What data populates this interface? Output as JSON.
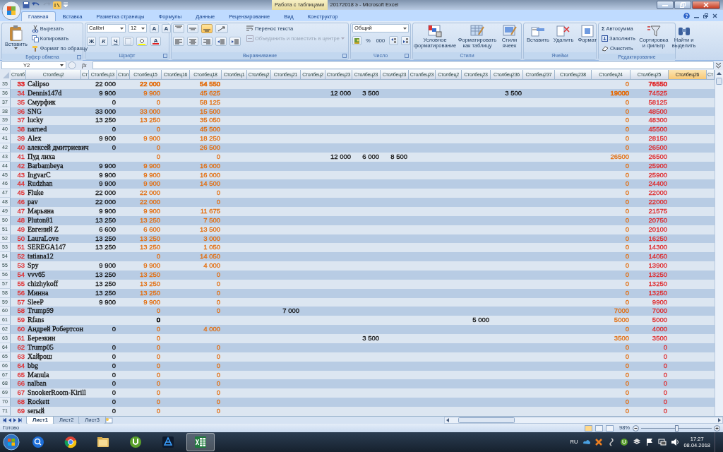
{
  "title_bar": {
    "contextual_tab": "Работа с таблицами",
    "title": "20172018 э - Microsoft Excel"
  },
  "ribbon_tabs": [
    {
      "label": "Главная",
      "selected": true
    },
    {
      "label": "Вставка",
      "selected": false
    },
    {
      "label": "Разметка страницы",
      "selected": false
    },
    {
      "label": "Формулы",
      "selected": false
    },
    {
      "label": "Данные",
      "selected": false
    },
    {
      "label": "Рецензирование",
      "selected": false
    },
    {
      "label": "Вид",
      "selected": false
    },
    {
      "label": "Конструктор",
      "selected": false
    }
  ],
  "ribbon": {
    "clipboard": {
      "paste": "Вставить",
      "cut": "Вырезать",
      "copy": "Копировать",
      "format_painter": "Формат по образцу",
      "label": "Буфер обмена"
    },
    "font": {
      "name": "Calibri",
      "size": "12",
      "grow": "A",
      "shrink": "A",
      "bold": "Ж",
      "italic": "К",
      "underline": "Ч",
      "font_color": "A",
      "label": "Шрифт"
    },
    "alignment": {
      "vertical": [
        {
          "selected": false
        },
        {
          "selected": false
        },
        {
          "selected": true
        }
      ],
      "wrap": "Перенос текста",
      "merge": "Объединить и поместить в центре",
      "merge_disabled": true,
      "label": "Выравнивание"
    },
    "number": {
      "format": "Общий",
      "percent": "%",
      "thousands": "000",
      "label": "Число"
    },
    "styles": {
      "conditional": "Условное форматирование",
      "as_table": "Форматировать как таблицу",
      "cell_styles": "Стили ячеек",
      "label": "Стили"
    },
    "cells": {
      "insert": "Вставить",
      "delete": "Удалить",
      "format": "Формат",
      "label": "Ячейки"
    },
    "editing": {
      "sigma": "Σ",
      "autosum": "Автосумма",
      "fill": "Заполнить",
      "clear": "Очистить",
      "sort": "Сортировка и фильтр",
      "find": "Найти и выделить",
      "label": "Редактирование"
    }
  },
  "formula_bar": {
    "name_box": "Y2",
    "fx": "fx"
  },
  "columns": [
    {
      "label": "Столб",
      "selected": false,
      "kind": "number",
      "color": "#e0282a"
    },
    {
      "label": "Столбец2",
      "selected": false,
      "kind": "text"
    },
    {
      "label": "Ст",
      "selected": false,
      "kind": "number"
    },
    {
      "label": "Столбец13",
      "selected": false,
      "kind": "number"
    },
    {
      "label": "Стол",
      "selected": false,
      "kind": "number"
    },
    {
      "label": "Столбец15",
      "selected": false,
      "kind": "number",
      "color": "#e46c0a"
    },
    {
      "label": "Столбец16",
      "selected": false,
      "kind": "number"
    },
    {
      "label": "Столбец18",
      "selected": false,
      "kind": "number",
      "color": "#e46c0a"
    },
    {
      "label": "Столбец1",
      "selected": false,
      "kind": "number"
    },
    {
      "label": "Столбец2",
      "selected": false,
      "kind": "number"
    },
    {
      "label": "Столбец21",
      "selected": false,
      "kind": "number"
    },
    {
      "label": "Столбец2",
      "selected": false,
      "kind": "number"
    },
    {
      "label": "Столбец23",
      "selected": false,
      "kind": "number"
    },
    {
      "label": "Столбец23",
      "selected": false,
      "kind": "number"
    },
    {
      "label": "Столбец23",
      "selected": false,
      "kind": "number"
    },
    {
      "label": "Столбец23",
      "selected": false,
      "kind": "number"
    },
    {
      "label": "Столбец2",
      "selected": false,
      "kind": "number"
    },
    {
      "label": "Столбец23",
      "selected": false,
      "kind": "number"
    },
    {
      "label": "Столбец236",
      "selected": false,
      "kind": "number"
    },
    {
      "label": "Столбец237",
      "selected": false,
      "kind": "number"
    },
    {
      "label": "Столбец238",
      "selected": false,
      "kind": "number"
    },
    {
      "label": "Столбец24",
      "selected": false,
      "kind": "number",
      "color": "#e46c0a"
    },
    {
      "label": "Столбец25",
      "selected": false,
      "kind": "number",
      "color": "#e0282a"
    },
    {
      "label": "Столбец26",
      "selected": true,
      "kind": "number"
    },
    {
      "label": "Ст",
      "selected": false,
      "kind": "number"
    }
  ],
  "rows": [
    {
      "header": "35",
      "cells": [
        "33",
        "Calipso",
        null,
        "22 000",
        null,
        "22 000",
        null,
        "54 550",
        null,
        null,
        null,
        null,
        null,
        null,
        null,
        null,
        null,
        null,
        null,
        null,
        null,
        "0",
        "76550"
      ]
    },
    {
      "header": "36",
      "cells": [
        "34",
        "Dennis147d",
        null,
        "9 900",
        null,
        "9 900",
        null,
        "45 625",
        null,
        null,
        null,
        null,
        "12 000",
        "3 500",
        null,
        null,
        null,
        null,
        "3 500",
        null,
        null,
        "19000",
        "74525"
      ]
    },
    {
      "header": "37",
      "cells": [
        "35",
        "Смурфик",
        null,
        "0",
        null,
        "0",
        null,
        "58 125",
        null,
        null,
        null,
        null,
        null,
        null,
        null,
        null,
        null,
        null,
        null,
        null,
        null,
        "0",
        "58125"
      ]
    },
    {
      "header": "38",
      "cells": [
        "36",
        "SNG",
        null,
        "33 000",
        null,
        "33 000",
        null,
        "15 500",
        null,
        null,
        null,
        null,
        null,
        null,
        null,
        null,
        null,
        null,
        null,
        null,
        null,
        "0",
        "48500"
      ]
    },
    {
      "header": "39",
      "cells": [
        "37",
        "lucky",
        null,
        "13 250",
        null,
        "13 250",
        null,
        "35 050",
        null,
        null,
        null,
        null,
        null,
        null,
        null,
        null,
        null,
        null,
        null,
        null,
        null,
        "0",
        "48300"
      ]
    },
    {
      "header": "40",
      "cells": [
        "38",
        "narned",
        null,
        "0",
        null,
        "0",
        null,
        "45 500",
        null,
        null,
        null,
        null,
        null,
        null,
        null,
        null,
        null,
        null,
        null,
        null,
        null,
        "0",
        "45500"
      ]
    },
    {
      "header": "41",
      "cells": [
        "39",
        "Alex",
        null,
        "9 900",
        null,
        "9 900",
        null,
        "18 250",
        null,
        null,
        null,
        null,
        null,
        null,
        null,
        null,
        null,
        null,
        null,
        null,
        null,
        "0",
        "28150"
      ]
    },
    {
      "header": "42",
      "cells": [
        "40",
        "алексей дмитриевич",
        null,
        "0",
        null,
        "0",
        null,
        "26 500",
        null,
        null,
        null,
        null,
        null,
        null,
        null,
        null,
        null,
        null,
        null,
        null,
        null,
        "0",
        "26500"
      ]
    },
    {
      "header": "43",
      "cells": [
        "41",
        "Пуд лиха",
        null,
        null,
        null,
        "0",
        null,
        "0",
        null,
        null,
        null,
        null,
        "12 000",
        "6 000",
        "8 500",
        null,
        null,
        null,
        null,
        null,
        null,
        "26500",
        "26500"
      ]
    },
    {
      "header": "44",
      "cells": [
        "42",
        "Barbambeya",
        null,
        "9 900",
        null,
        "9 900",
        null,
        "16 000",
        null,
        null,
        null,
        null,
        null,
        null,
        null,
        null,
        null,
        null,
        null,
        null,
        null,
        "0",
        "25900"
      ]
    },
    {
      "header": "45",
      "cells": [
        "43",
        "IngvarC",
        null,
        "9 900",
        null,
        "9 900",
        null,
        "16 000",
        null,
        null,
        null,
        null,
        null,
        null,
        null,
        null,
        null,
        null,
        null,
        null,
        null,
        "0",
        "25900"
      ]
    },
    {
      "header": "46",
      "cells": [
        "44",
        "Rudzhan",
        null,
        "9 900",
        null,
        "9 900",
        null,
        "14 500",
        null,
        null,
        null,
        null,
        null,
        null,
        null,
        null,
        null,
        null,
        null,
        null,
        null,
        "0",
        "24400"
      ]
    },
    {
      "header": "47",
      "cells": [
        "45",
        "Fluke",
        null,
        "22 000",
        null,
        "22 000",
        null,
        "0",
        null,
        null,
        null,
        null,
        null,
        null,
        null,
        null,
        null,
        null,
        null,
        null,
        null,
        "0",
        "22000"
      ]
    },
    {
      "header": "48",
      "cells": [
        "46",
        "pav",
        null,
        "22 000",
        null,
        "22 000",
        null,
        "0",
        null,
        null,
        null,
        null,
        null,
        null,
        null,
        null,
        null,
        null,
        null,
        null,
        null,
        "0",
        "22000"
      ]
    },
    {
      "header": "49",
      "cells": [
        "47",
        "Марьяна",
        null,
        "9 900",
        null,
        "9 900",
        null,
        "11 675",
        null,
        null,
        null,
        null,
        null,
        null,
        null,
        null,
        null,
        null,
        null,
        null,
        null,
        "0",
        "21575"
      ]
    },
    {
      "header": "50",
      "cells": [
        "48",
        "Pluton81",
        null,
        "13 250",
        null,
        "13 250",
        null,
        "7 500",
        null,
        null,
        null,
        null,
        null,
        null,
        null,
        null,
        null,
        null,
        null,
        null,
        null,
        "0",
        "20750"
      ]
    },
    {
      "header": "51",
      "cells": [
        "49",
        "Евгений Z",
        null,
        "6 600",
        null,
        "6 600",
        null,
        "13 500",
        null,
        null,
        null,
        null,
        null,
        null,
        null,
        null,
        null,
        null,
        null,
        null,
        null,
        "0",
        "20100"
      ]
    },
    {
      "header": "52",
      "cells": [
        "50",
        "LauraLove",
        null,
        "13 250",
        null,
        "13 250",
        null,
        "3 000",
        null,
        null,
        null,
        null,
        null,
        null,
        null,
        null,
        null,
        null,
        null,
        null,
        null,
        "0",
        "16250"
      ]
    },
    {
      "header": "53",
      "cells": [
        "51",
        "SEREGA147",
        null,
        "13 250",
        null,
        "13 250",
        null,
        "1 050",
        null,
        null,
        null,
        null,
        null,
        null,
        null,
        null,
        null,
        null,
        null,
        null,
        null,
        "0",
        "14300"
      ]
    },
    {
      "header": "54",
      "cells": [
        "52",
        "tatiana12",
        null,
        null,
        null,
        "0",
        null,
        "14 050",
        null,
        null,
        null,
        null,
        null,
        null,
        null,
        null,
        null,
        null,
        null,
        null,
        null,
        "0",
        "14050"
      ]
    },
    {
      "header": "55",
      "cells": [
        "53",
        "Spy",
        null,
        "9 900",
        null,
        "9 900",
        null,
        "4 000",
        null,
        null,
        null,
        null,
        null,
        null,
        null,
        null,
        null,
        null,
        null,
        null,
        null,
        "0",
        "13900"
      ]
    },
    {
      "header": "56",
      "cells": [
        "54",
        "vvv65",
        null,
        "13 250",
        null,
        "13 250",
        null,
        "0",
        null,
        null,
        null,
        null,
        null,
        null,
        null,
        null,
        null,
        null,
        null,
        null,
        null,
        "0",
        "13250"
      ]
    },
    {
      "header": "57",
      "cells": [
        "55",
        "chizhykoff",
        null,
        "13 250",
        null,
        "13 250",
        null,
        "0",
        null,
        null,
        null,
        null,
        null,
        null,
        null,
        null,
        null,
        null,
        null,
        null,
        null,
        "0",
        "13250"
      ]
    },
    {
      "header": "58",
      "cells": [
        "56",
        "Минна",
        null,
        "13 250",
        null,
        "13 250",
        null,
        "0",
        null,
        null,
        null,
        null,
        null,
        null,
        null,
        null,
        null,
        null,
        null,
        null,
        null,
        "0",
        "13250"
      ]
    },
    {
      "header": "59",
      "cells": [
        "57",
        "SleeP",
        null,
        "9 900",
        null,
        "9 900",
        null,
        "0",
        null,
        null,
        null,
        null,
        null,
        null,
        null,
        null,
        null,
        null,
        null,
        null,
        null,
        "0",
        "9900"
      ]
    },
    {
      "header": "60",
      "cells": [
        "58",
        "Trump99",
        null,
        null,
        null,
        "0",
        null,
        "0",
        null,
        null,
        "7 000",
        null,
        null,
        null,
        null,
        null,
        null,
        null,
        null,
        null,
        null,
        "7000",
        "7000"
      ]
    },
    {
      "header": "61",
      "cells": [
        "59",
        "Rfans",
        null,
        null,
        null,
        {
          "text": "0",
          "color": "#000000"
        },
        null,
        null,
        null,
        null,
        null,
        null,
        null,
        null,
        null,
        null,
        null,
        "5 000",
        null,
        null,
        null,
        "5000",
        "5000"
      ]
    },
    {
      "header": "62",
      "cells": [
        "60",
        "Андрей Робертсон",
        null,
        "0",
        null,
        "0",
        null,
        "4 000",
        null,
        null,
        null,
        null,
        null,
        null,
        null,
        null,
        null,
        null,
        null,
        null,
        null,
        "0",
        "4000"
      ]
    },
    {
      "header": "63",
      "cells": [
        "61",
        "Березкин",
        null,
        null,
        null,
        "0",
        null,
        null,
        null,
        null,
        null,
        null,
        null,
        "3 500",
        null,
        null,
        null,
        null,
        null,
        null,
        null,
        "3500",
        "3500"
      ]
    },
    {
      "header": "64",
      "cells": [
        "62",
        "Trump05",
        null,
        "0",
        null,
        "0",
        null,
        "0",
        null,
        null,
        null,
        null,
        null,
        null,
        null,
        null,
        null,
        null,
        null,
        null,
        null,
        "0",
        "0"
      ]
    },
    {
      "header": "65",
      "cells": [
        "63",
        "Хайрош",
        null,
        "0",
        null,
        "0",
        null,
        "0",
        null,
        null,
        null,
        null,
        null,
        null,
        null,
        null,
        null,
        null,
        null,
        null,
        null,
        "0",
        "0"
      ]
    },
    {
      "header": "66",
      "cells": [
        "64",
        "bbg",
        null,
        "0",
        null,
        "0",
        null,
        "0",
        null,
        null,
        null,
        null,
        null,
        null,
        null,
        null,
        null,
        null,
        null,
        null,
        null,
        "0",
        "0"
      ]
    },
    {
      "header": "67",
      "cells": [
        "65",
        "Manula",
        null,
        "0",
        null,
        "0",
        null,
        "0",
        null,
        null,
        null,
        null,
        null,
        null,
        null,
        null,
        null,
        null,
        null,
        null,
        null,
        "0",
        "0"
      ]
    },
    {
      "header": "68",
      "cells": [
        "66",
        "nalban",
        null,
        "0",
        null,
        "0",
        null,
        "0",
        null,
        null,
        null,
        null,
        null,
        null,
        null,
        null,
        null,
        null,
        null,
        null,
        null,
        "0",
        "0"
      ]
    },
    {
      "header": "69",
      "cells": [
        "67",
        "SnookerRoom-Kirill",
        null,
        "0",
        null,
        "0",
        null,
        "0",
        null,
        null,
        null,
        null,
        null,
        null,
        null,
        null,
        null,
        null,
        null,
        null,
        null,
        "0",
        "0"
      ]
    },
    {
      "header": "70",
      "cells": [
        "68",
        "Rockett",
        null,
        "0",
        null,
        "0",
        null,
        "0",
        null,
        null,
        null,
        null,
        null,
        null,
        null,
        null,
        null,
        null,
        null,
        null,
        null,
        "0",
        "0"
      ]
    },
    {
      "header": "71",
      "cells": [
        "69",
        "serый",
        null,
        "0",
        null,
        "0",
        null,
        "0",
        null,
        null,
        null,
        null,
        null,
        null,
        null,
        null,
        null,
        null,
        null,
        null,
        null,
        "0",
        "0"
      ]
    }
  ],
  "sheet_tabs": [
    {
      "label": "Лист1",
      "selected": true
    },
    {
      "label": "Лист2",
      "selected": false
    },
    {
      "label": "Лист3",
      "selected": false
    }
  ],
  "status_bar": {
    "status": "Готово",
    "views": [
      {
        "selected": true
      },
      {
        "selected": false
      },
      {
        "selected": false
      }
    ],
    "zoom": "98%",
    "level": 0.5
  },
  "taskbar": {
    "apps": [
      {
        "kind": "search",
        "selected": false
      },
      {
        "kind": "browser",
        "selected": false
      },
      {
        "kind": "folder",
        "selected": false
      },
      {
        "kind": "torrent",
        "selected": false
      },
      {
        "kind": "app",
        "selected": false
      },
      {
        "kind": "spreadsheet",
        "selected": true
      }
    ],
    "language": "RU",
    "time": "17:27",
    "date": "08.04.2018"
  }
}
